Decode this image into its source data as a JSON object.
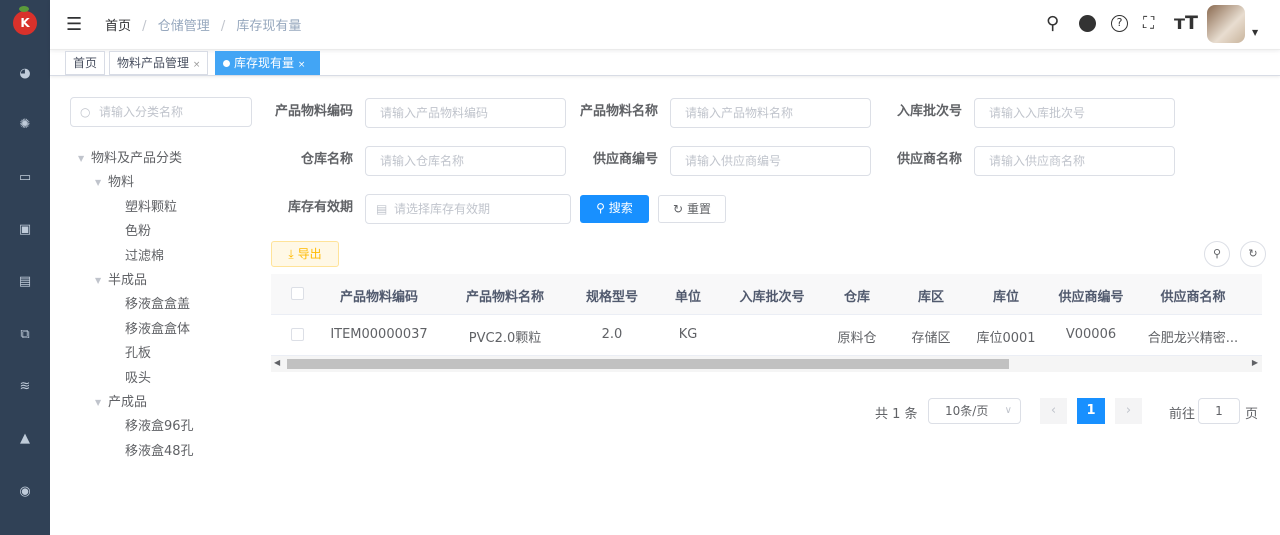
{
  "breadcrumb": [
    "首页",
    "仓储管理",
    "库存现有量"
  ],
  "tabs": [
    {
      "label": "首页"
    },
    {
      "label": "物料产品管理"
    },
    {
      "label": "库存现有量"
    }
  ],
  "tree": {
    "search_placeholder": "请输入分类名称",
    "nodes": [
      {
        "label": "物料及产品分类",
        "level": 0,
        "expanded": true
      },
      {
        "label": "物料",
        "level": 1,
        "expanded": true
      },
      {
        "label": "塑料颗粒",
        "level": 2
      },
      {
        "label": "色粉",
        "level": 2
      },
      {
        "label": "过滤棉",
        "level": 2
      },
      {
        "label": "半成品",
        "level": 1,
        "expanded": true
      },
      {
        "label": "移液盒盒盖",
        "level": 2
      },
      {
        "label": "移液盒盒体",
        "level": 2
      },
      {
        "label": "孔板",
        "level": 2
      },
      {
        "label": "吸头",
        "level": 2
      },
      {
        "label": "产成品",
        "level": 1,
        "expanded": true
      },
      {
        "label": "移液盒96孔",
        "level": 2
      },
      {
        "label": "移液盒48孔",
        "level": 2
      }
    ]
  },
  "form": {
    "code_label": "产品物料编码",
    "code_placeholder": "请输入产品物料编码",
    "name_label": "产品物料名称",
    "name_placeholder": "请输入产品物料名称",
    "batch_label": "入库批次号",
    "batch_placeholder": "请输入入库批次号",
    "warehouse_label": "仓库名称",
    "warehouse_placeholder": "请输入仓库名称",
    "vendor_code_label": "供应商编号",
    "vendor_code_placeholder": "请输入供应商编号",
    "vendor_name_label": "供应商名称",
    "vendor_name_placeholder": "请输入供应商名称",
    "expire_label": "库存有效期",
    "expire_placeholder": "请选择库存有效期",
    "search": "搜索",
    "reset": "重置"
  },
  "toolbar": {
    "export": "导出"
  },
  "table": {
    "columns": [
      "产品物料编码",
      "产品物料名称",
      "规格型号",
      "单位",
      "入库批次号",
      "仓库",
      "库区",
      "库位",
      "供应商编号",
      "供应商名称"
    ],
    "rows": [
      [
        "ITEM00000037",
        "PVC2.0颗粒",
        "2.0",
        "KG",
        "",
        "原料仓",
        "存储区",
        "库位0001",
        "V00006",
        "合肥龙兴精密..."
      ]
    ]
  },
  "pagination": {
    "total": "共 1 条",
    "page_size": "10条/页",
    "current": "1",
    "goto_label": "前往",
    "goto_value": "1",
    "goto_suffix": "页"
  },
  "colors": {
    "sidebar": "#304156",
    "primary": "#1890ff",
    "active_tab": "#42a5f5"
  }
}
